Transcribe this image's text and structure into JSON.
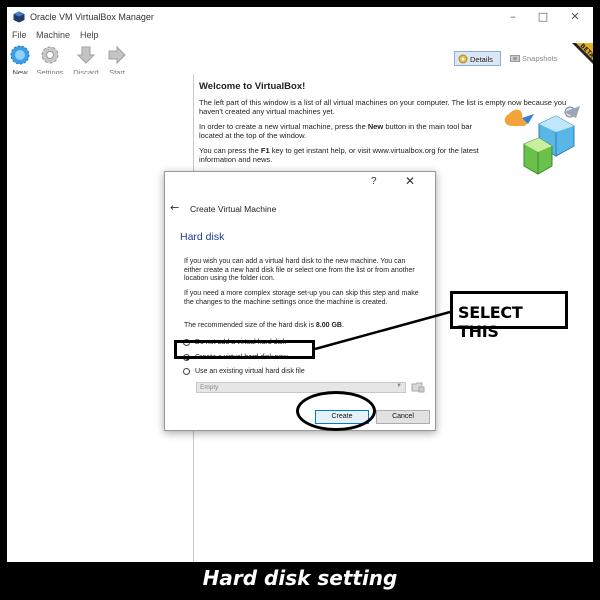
{
  "window": {
    "title": "Oracle VM VirtualBox Manager"
  },
  "menu": [
    "File",
    "Machine",
    "Help"
  ],
  "toolbar": {
    "new_label": "New",
    "settings_label": "Settings",
    "discard_label": "Discard",
    "start_label": "Start",
    "details_label": "Details",
    "snapshots_label": "Snapshots"
  },
  "welcome": {
    "title": "Welcome to VirtualBox!",
    "p1": "The left part of this window is a list of all virtual machines on your computer. The list is empty now because you haven't created any virtual machines yet.",
    "p2_before": "In order to create a new virtual machine, press the ",
    "p2_bold": "New",
    "p2_after": " button in the main tool bar located at the top of the window.",
    "p3_before": "You can press the ",
    "p3_bold": "F1",
    "p3_after": " key to get instant help, or visit www.virtualbox.org for the latest information and news."
  },
  "dialog": {
    "help": "?",
    "close": "✕",
    "title": "Create Virtual Machine",
    "heading": "Hard disk",
    "p1": "If you wish you can add a virtual hard disk to the new machine. You can either create a new hard disk file or select one from the list or from another location using the folder icon.",
    "p2": "If you need a more complex storage set-up you can skip this step and make the changes to the machine settings once the machine is created.",
    "recommended_before": "The recommended size of the hard disk is ",
    "recommended_size": "8.00 GB",
    "recommended_after": ".",
    "options": [
      {
        "label": "Do not add a virtual hard disk",
        "selected": false
      },
      {
        "label": "Create a virtual hard disk now",
        "selected": true
      },
      {
        "label": "Use an existing virtual hard disk file",
        "selected": false
      }
    ],
    "existing_file_value": "Empty",
    "create_label": "Create",
    "cancel_label": "Cancel"
  },
  "annotation": {
    "callout": "SELECT THIS"
  },
  "caption": "Hard disk setting"
}
